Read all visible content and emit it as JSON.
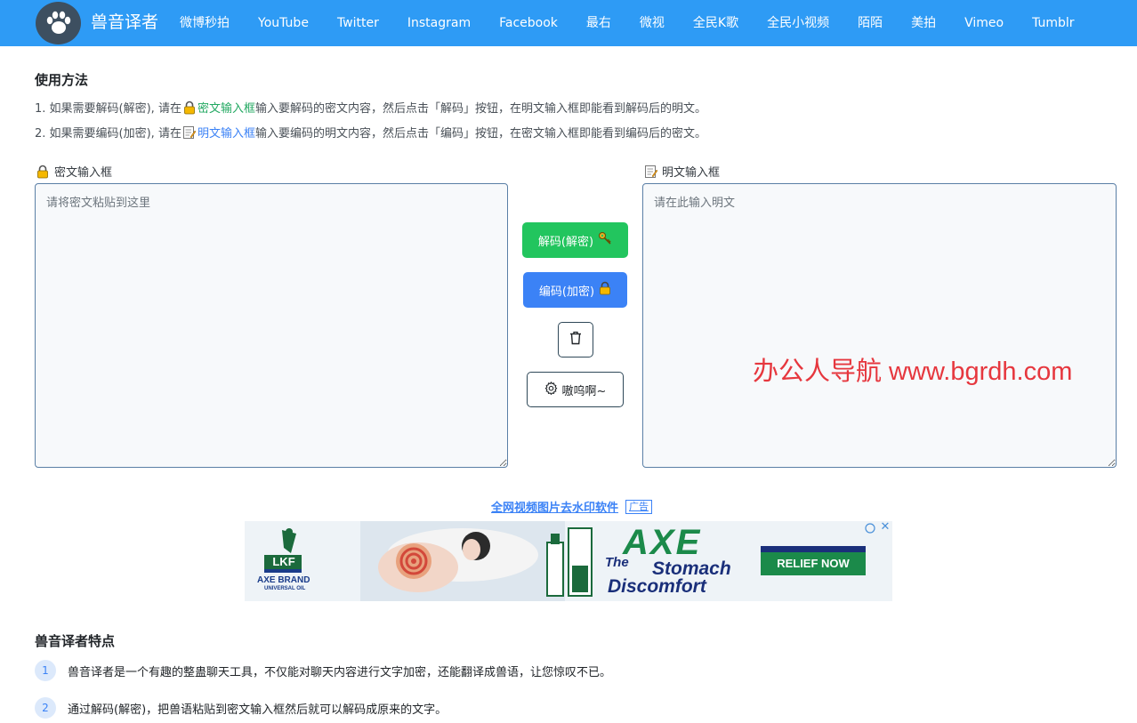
{
  "nav": {
    "brand": "兽音译者",
    "items": [
      "微博秒拍",
      "YouTube",
      "Twitter",
      "Instagram",
      "Facebook",
      "最右",
      "微视",
      "全民K歌",
      "全民小视频",
      "陌陌",
      "美拍",
      "Vimeo",
      "Tumblr"
    ]
  },
  "usage": {
    "title": "使用方法",
    "line1": {
      "pre": "1. 如果需要解码(解密), 请在",
      "highlight": "密文输入框",
      "post": "输入要解码的密文内容，然后点击「解码」按钮，在明文输入框即能看到解码后的明文。"
    },
    "line2": {
      "pre": "2. 如果需要编码(加密), 请在",
      "highlight": "明文输入框",
      "post": "输入要编码的明文内容，然后点击「编码」按钮，在密文输入框即能看到编码后的密文。"
    }
  },
  "cipher": {
    "label": "密文输入框",
    "placeholder": "请将密文粘贴到这里",
    "value": ""
  },
  "plain": {
    "label": "明文输入框",
    "placeholder": "请在此输入明文",
    "value": ""
  },
  "buttons": {
    "decode": "解码(解密)",
    "encode": "编码(加密)",
    "setting": "嗷呜啊~"
  },
  "watermark": "办公人导航 www.bgrdh.com",
  "ad": {
    "link_text": "全网视频图片去水印软件",
    "tag": "广告",
    "banner": {
      "logo_text": "LKF",
      "brand_line1": "AXE BRAND",
      "brand_line2": "UNIVERSAL OIL",
      "headline_big": "AXE",
      "headline_the": "The",
      "headline_line1": "Stomach",
      "headline_line2": "Discomfort",
      "cta": "RELIEF NOW"
    }
  },
  "features": {
    "title": "兽音译者特点",
    "items": [
      {
        "num": "1",
        "text": "兽音译者是一个有趣的整蛊聊天工具，不仅能对聊天内容进行文字加密，还能翻译成兽语，让您惊叹不已。"
      },
      {
        "num": "2",
        "text": "通过解码(解密)，把兽语粘贴到密文输入框然后就可以解码成原来的文字。"
      }
    ]
  },
  "colors": {
    "navbar": "#2e9bf5",
    "decode_button": "#22c55e",
    "encode_button": "#3b82f6",
    "watermark": "#e6373e"
  }
}
